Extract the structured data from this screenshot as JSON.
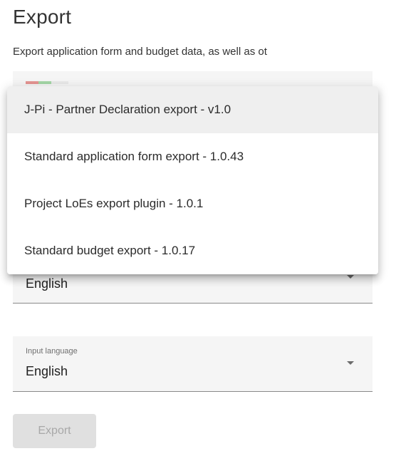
{
  "header": {
    "title": "Export",
    "subtitle": "Export application form and budget data, as well as ot"
  },
  "plugin_select": {
    "options": [
      {
        "label": "J-Pi - Partner Declaration export - v1.0",
        "active": true
      },
      {
        "label": "Standard application form export - 1.0.43",
        "active": false
      },
      {
        "label": "Project LoEs export plugin - 1.0.1",
        "active": false
      },
      {
        "label": "Standard budget export - 1.0.17",
        "active": false
      }
    ]
  },
  "export_language": {
    "value": "English"
  },
  "input_language": {
    "label": "Input language",
    "value": "English"
  },
  "actions": {
    "export_label": "Export"
  },
  "colors": {
    "primary_text": "#212121",
    "field_background": "#f5f5f5",
    "disabled_button": "#e0e0e0",
    "disabled_text": "#a8a8a8"
  },
  "icons": {
    "dropdown_arrow": "chevron-down-icon"
  }
}
